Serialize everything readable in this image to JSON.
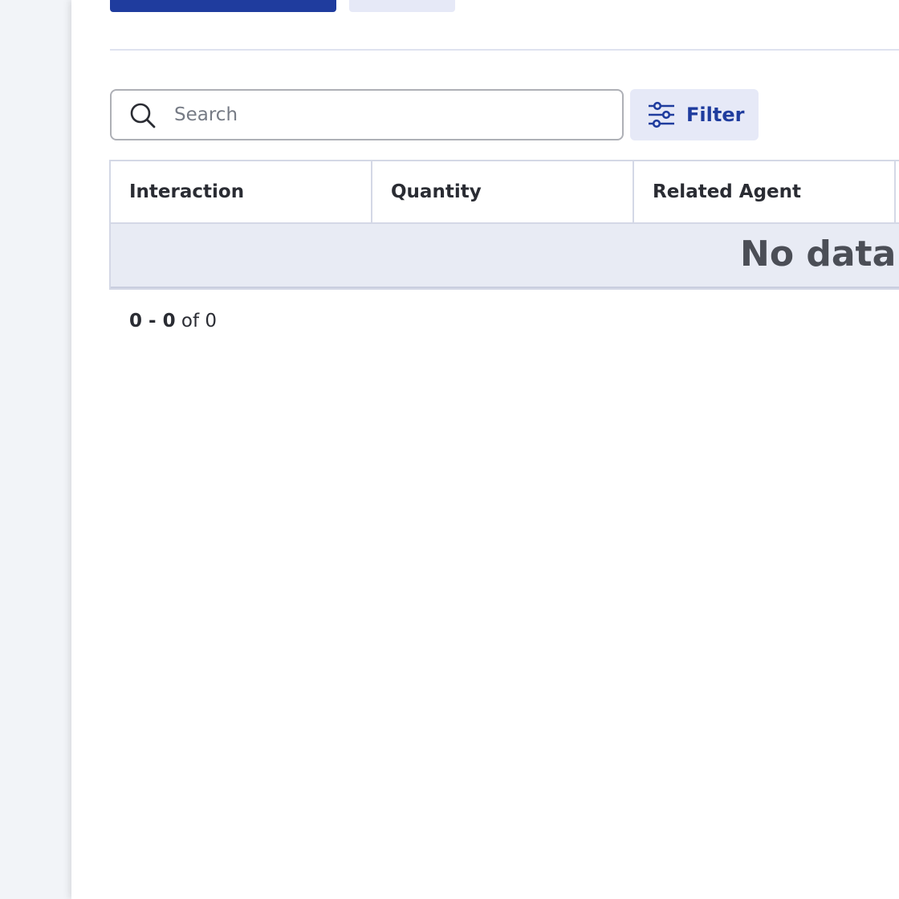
{
  "search": {
    "placeholder": "Search"
  },
  "filter": {
    "label": "Filter"
  },
  "table": {
    "columns": [
      "Interaction",
      "Quantity",
      "Related Agent"
    ],
    "empty_message": "No data available"
  },
  "pagination": {
    "range": "0 - 0",
    "of_word": "of",
    "total": "0"
  },
  "colors": {
    "primary": "#1f3c9e",
    "secondary_bg": "#e6e9f7"
  }
}
